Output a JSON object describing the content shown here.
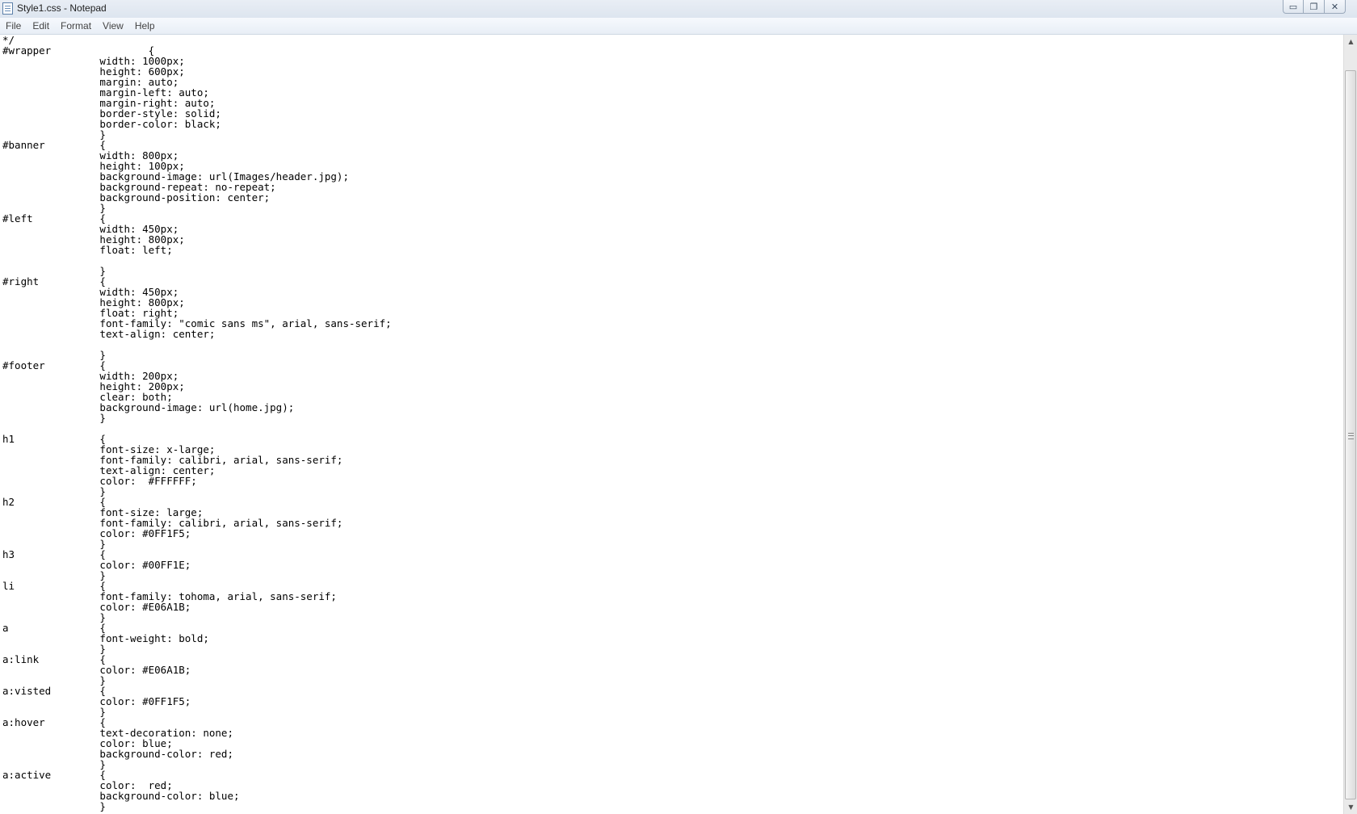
{
  "window": {
    "title": "Style1.css - Notepad",
    "controls": {
      "minimize": "▭",
      "maximize": "❐",
      "close": "✕"
    }
  },
  "menu": {
    "items": [
      "File",
      "Edit",
      "Format",
      "View",
      "Help"
    ]
  },
  "editor": {
    "content": "*/\n#wrapper\t\t{\n\t\twidth: 1000px;\n\t\theight: 600px;\n\t\tmargin: auto;\n\t\tmargin-left: auto;\n\t\tmargin-right: auto;\n\t\tborder-style: solid;\n\t\tborder-color: black;\n\t\t}\n#banner\t\t{\n\t\twidth: 800px;\n\t\theight: 100px;\n\t\tbackground-image: url(Images/header.jpg);\n\t\tbackground-repeat: no-repeat;\n\t\tbackground-position: center;\n\t\t}\n#left\t\t{\n\t\twidth: 450px;\n\t\theight: 800px;\n\t\tfloat: left;\n\n\t\t}\n#right\t\t{\n\t\twidth: 450px;\n\t\theight: 800px;\n\t\tfloat: right;\n\t\tfont-family: \"comic sans ms\", arial, sans-serif;\n\t\ttext-align: center;\n\n\t\t}\n#footer\t\t{\n\t\twidth: 200px;\n\t\theight: 200px;\n\t\tclear: both;\n\t\tbackground-image: url(home.jpg);\n\t\t}\n\nh1\t\t{\n\t\tfont-size: x-large;\n\t\tfont-family: calibri, arial, sans-serif;\n\t\ttext-align: center;\n\t\tcolor:  #FFFFFF;\n\t\t}\nh2\t\t{\n\t\tfont-size: large;\n\t\tfont-family: calibri, arial, sans-serif;\n\t\tcolor: #0FF1F5;\n\t\t}\nh3\t\t{\n\t\tcolor: #00FF1E;\n\t\t}\nli\t\t{\n\t\tfont-family: tohoma, arial, sans-serif;\n\t\tcolor: #E06A1B;\n\t\t}\na\t\t{\n\t\tfont-weight: bold;\n\t\t}\na:link\t\t{\n\t\tcolor: #E06A1B;\n\t\t}\na:visted\t{\n\t\tcolor: #0FF1F5;\n\t\t}\na:hover\t\t{\n\t\ttext-decoration: none;\n\t\tcolor: blue;\n\t\tbackground-color: red;\n\t\t}\na:active\t{\n\t\tcolor:  red;\n\t\tbackground-color: blue;\n\t\t}"
  },
  "scrollbar": {
    "up_arrow": "▲",
    "down_arrow": "▼",
    "position": 0.03
  }
}
